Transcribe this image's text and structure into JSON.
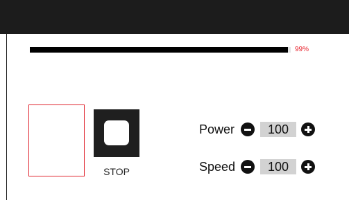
{
  "progress": {
    "percent": 99,
    "label": "99%",
    "color": "#e8202a"
  },
  "stop": {
    "label": "STOP",
    "icon": "stop-icon"
  },
  "controls": {
    "power": {
      "label": "Power",
      "value": "100",
      "decrease_icon": "minus-icon",
      "increase_icon": "plus-icon"
    },
    "speed": {
      "label": "Speed",
      "value": "100",
      "decrease_icon": "minus-icon",
      "increase_icon": "plus-icon"
    }
  },
  "colors": {
    "top_bar": "#1c1c1c",
    "preview_border": "#e0242e",
    "value_background": "#d2d2d2"
  }
}
